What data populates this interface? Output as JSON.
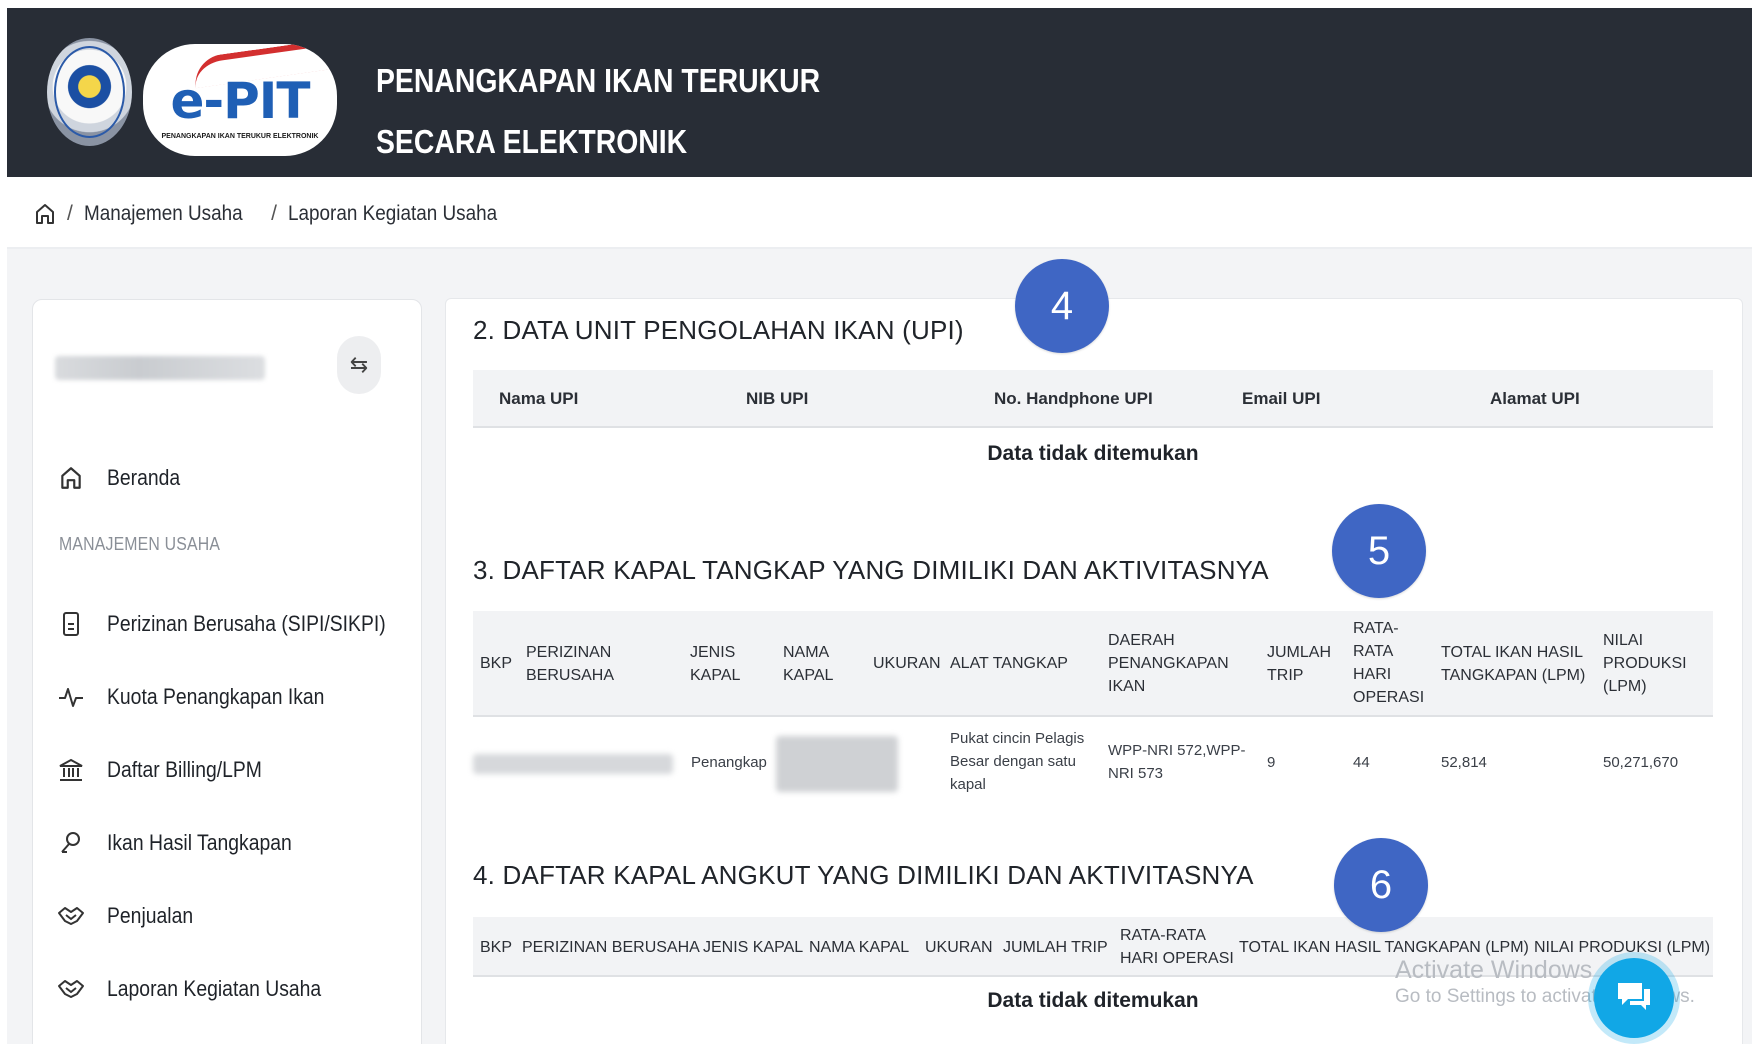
{
  "header": {
    "logo_text": "e-PIT",
    "logo_subtitle": "PENANGKAPAN IKAN TERUKUR ELEKTRONIK",
    "title_line1": "PENANGKAPAN IKAN TERUKUR",
    "title_line2": "SECARA ELEKTRONIK"
  },
  "breadcrumb": {
    "items": [
      "Manajemen Usaha",
      "Laporan Kegiatan Usaha"
    ],
    "separator": "/"
  },
  "sidebar": {
    "home_label": "Beranda",
    "section_heading": "MANAJEMEN USAHA",
    "items": [
      {
        "label": "Perizinan Berusaha (SIPI/SIKPI)",
        "icon": "document-icon"
      },
      {
        "label": "Kuota Penangkapan Ikan",
        "icon": "activity-icon"
      },
      {
        "label": "Daftar Billing/LPM",
        "icon": "bank-icon"
      },
      {
        "label": "Ikan Hasil Tangkapan",
        "icon": "fish-hook-icon"
      },
      {
        "label": "Penjualan",
        "icon": "handshake-icon"
      },
      {
        "label": "Laporan Kegiatan Usaha",
        "icon": "handshake-icon"
      }
    ]
  },
  "section_upi": {
    "title": "2. DATA UNIT PENGOLAHAN IKAN (UPI)",
    "columns": [
      "Nama UPI",
      "NIB UPI",
      "No. Handphone UPI",
      "Email UPI",
      "Alamat UPI"
    ],
    "empty_message": "Data tidak ditemukan"
  },
  "section_kapal_tangkap": {
    "title": "3. DAFTAR KAPAL TANGKAP YANG DIMILIKI DAN AKTIVITASNYA",
    "columns": [
      "BKP",
      "PERIZINAN BERUSAHA",
      "JENIS KAPAL",
      "NAMA KAPAL",
      "UKURAN",
      "ALAT TANGKAP",
      "DAERAH PENANGKAPAN IKAN",
      "JUMLAH TRIP",
      "RATA-RATA HARI OPERASI",
      "TOTAL IKAN HASIL TANGKAPAN (LPM)",
      "NILAI PRODUKSI (LPM)"
    ],
    "rows": [
      {
        "jenis_kapal": "Penangkap",
        "alat_tangkap": "Pukat cincin Pelagis Besar dengan satu kapal",
        "daerah": "WPP-NRI 572,WPP-NRI 573",
        "jumlah_trip": "9",
        "rata_hari": "44",
        "total_ikan": "52,814",
        "nilai_produksi": "50,271,670"
      }
    ]
  },
  "section_kapal_angkut": {
    "title": "4. DAFTAR KAPAL ANGKUT YANG DIMILIKI DAN AKTIVITASNYA",
    "columns": [
      "BKP",
      "PERIZINAN BERUSAHA",
      "JENIS KAPAL",
      "NAMA KAPAL",
      "UKURAN",
      "JUMLAH TRIP",
      "RATA-RATA HARI OPERASI",
      "TOTAL IKAN HASIL TANGKAPAN (LPM)",
      "NILAI PRODUKSI (LPM)"
    ],
    "empty_message": "Data tidak ditemukan"
  },
  "annotations": [
    "4",
    "5",
    "6"
  ],
  "watermark": {
    "line1": "Activate Windows",
    "line2": "Go to Settings to activate Windows."
  },
  "colors": {
    "header_bg": "#282d36",
    "badge": "#3f66c4",
    "chat": "#11a7e6"
  }
}
